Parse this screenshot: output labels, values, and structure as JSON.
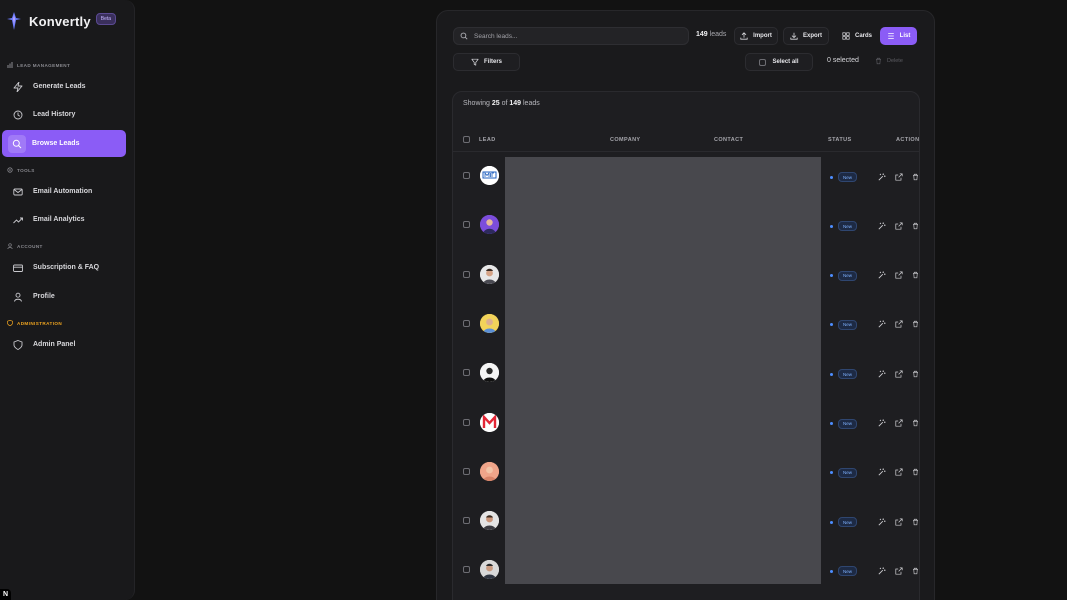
{
  "brand": {
    "name": "Konvertly",
    "badge": "Beta"
  },
  "sidebar": {
    "sections": [
      {
        "label": "LEAD MANAGEMENT"
      },
      {
        "label": "TOOLS"
      },
      {
        "label": "ACCOUNT"
      },
      {
        "label": "ADMINISTRATION"
      }
    ],
    "items": [
      {
        "label": "Generate Leads",
        "icon": "lightning-icon"
      },
      {
        "label": "Lead History",
        "icon": "history-icon"
      },
      {
        "label": "Browse Leads",
        "icon": "search-icon",
        "active": true
      },
      {
        "label": "Email Automation",
        "icon": "mail-icon"
      },
      {
        "label": "Email Analytics",
        "icon": "trend-up-icon"
      },
      {
        "label": "Subscription & FAQ",
        "icon": "credit-card-icon"
      },
      {
        "label": "Profile",
        "icon": "user-icon"
      },
      {
        "label": "Admin Panel",
        "icon": "shield-icon"
      }
    ]
  },
  "toolbar": {
    "search_placeholder": "Search leads...",
    "lead_count_number": "149",
    "lead_count_suffix": "leads",
    "import_label": "Import",
    "export_label": "Export",
    "cards_label": "Cards",
    "list_label": "List",
    "filters_label": "Filters",
    "select_all_label": "Select all",
    "selected_count": "0 selected",
    "delete_label": "Delete"
  },
  "table": {
    "showing_prefix": "Showing",
    "showing_count": "25",
    "showing_mid": "of",
    "showing_total": "149",
    "showing_suffix": "leads",
    "columns": {
      "lead": "LEAD",
      "company": "COMPANY",
      "contact": "CONTACT",
      "status": "STATUS",
      "actions": "ACTION"
    },
    "rows": [
      {
        "status": "New"
      },
      {
        "status": "New"
      },
      {
        "status": "New"
      },
      {
        "status": "New"
      },
      {
        "status": "New"
      },
      {
        "status": "New"
      },
      {
        "status": "New"
      },
      {
        "status": "New"
      },
      {
        "status": "New"
      }
    ]
  },
  "colors": {
    "accent": "#8b5cf6",
    "admin": "#f0a520",
    "status_new": "#4d8eff"
  }
}
